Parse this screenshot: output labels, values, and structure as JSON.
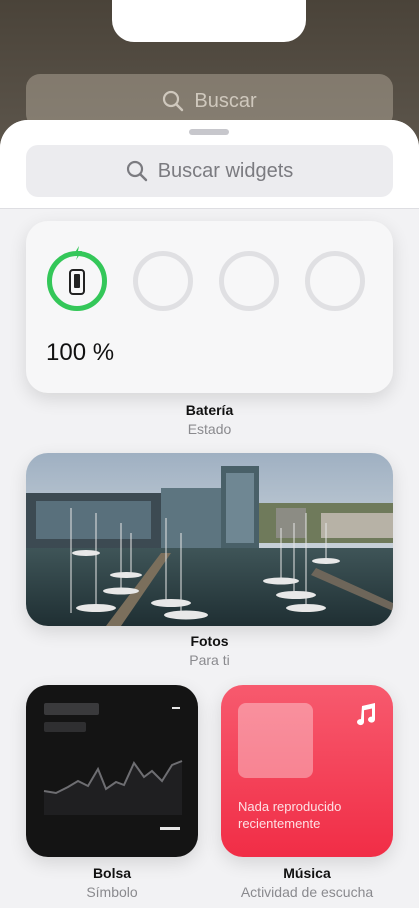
{
  "background": {
    "search_placeholder": "Buscar"
  },
  "sheet": {
    "search_placeholder": "Buscar widgets"
  },
  "widgets": {
    "battery": {
      "percent_text": "100 %",
      "title": "Batería",
      "subtitle": "Estado",
      "charge_level": 1.0
    },
    "photos": {
      "title": "Fotos",
      "subtitle": "Para ti"
    },
    "stocks": {
      "title": "Bolsa",
      "subtitle": "Símbolo"
    },
    "music": {
      "message": "Nada reproducido recientemente",
      "title": "Música",
      "subtitle": "Actividad de escucha"
    }
  },
  "colors": {
    "battery_green": "#34c759",
    "music_red": "#f12d46",
    "stocks_bg": "#141414"
  },
  "icons": [
    "search-icon",
    "bolt-icon",
    "iphone-icon",
    "music-note-icon"
  ]
}
